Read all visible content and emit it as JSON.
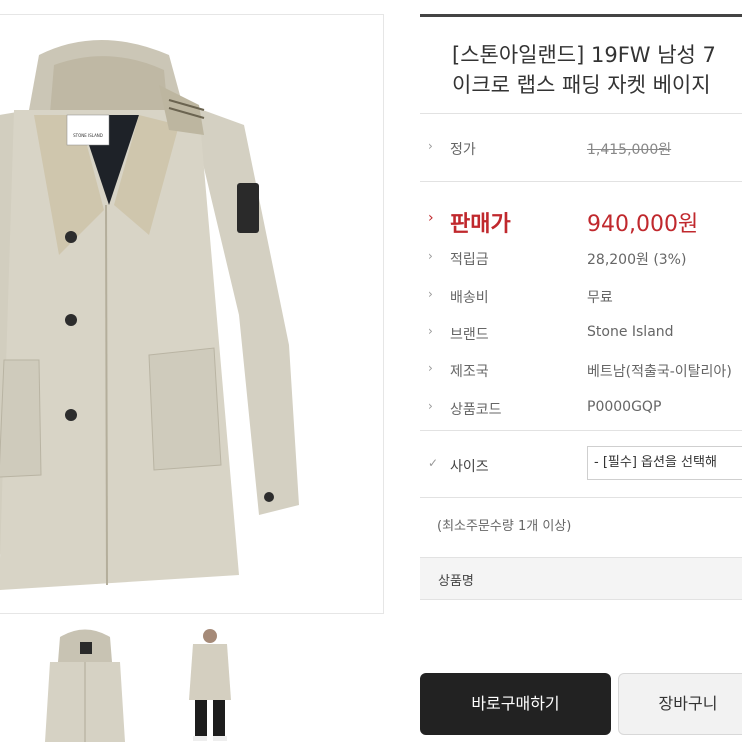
{
  "product": {
    "title_line1": "[스톤아일랜드] 19FW 남성 7",
    "title_line2": "이크로 랩스 패딩 자켓 베이지",
    "main_image_alt": "STONE ISLAND",
    "thumbnails": [
      "jacket-front",
      "jacket-full-body"
    ]
  },
  "info": {
    "list_price_label": "정가",
    "list_price": "1,415,000원",
    "sale_price_label": "판매가",
    "sale_price": "940,000원",
    "points_label": "적립금",
    "points": "28,200원 (3%)",
    "shipping_label": "배송비",
    "shipping": "무료",
    "brand_label": "브랜드",
    "brand": "Stone Island",
    "origin_label": "제조국",
    "origin": "베트남(적출국-이탈리아)",
    "code_label": "상품코드",
    "code": "P0000GQP"
  },
  "options": {
    "size_label": "사이즈",
    "size_select": "- [필수] 옵션을 선택해",
    "min_qty": "(최소주문수량 1개 이상)",
    "product_name_label": "상품명"
  },
  "actions": {
    "buy_now": "바로구매하기",
    "cart": "장바구니"
  },
  "colors": {
    "sale_red": "#c0282d",
    "buy_button": "#222222",
    "jacket": "#d6d2c5"
  }
}
